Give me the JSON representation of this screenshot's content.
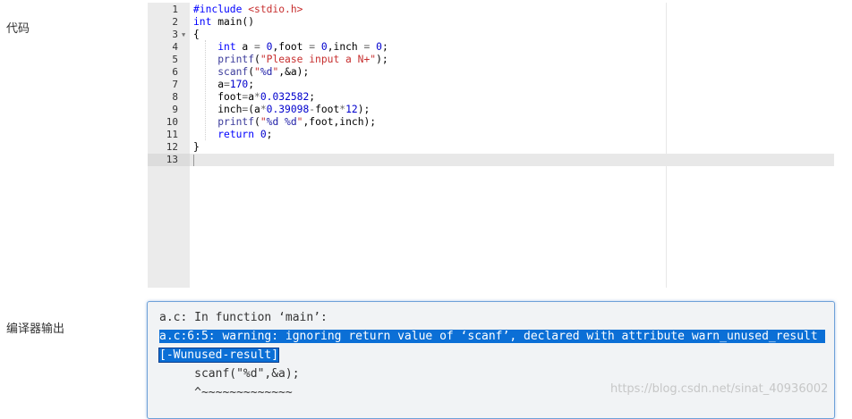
{
  "labels": {
    "code": "代码",
    "compiler_output": "编译器输出"
  },
  "editor": {
    "lines": [
      {
        "n": "1",
        "parts": [
          [
            "pp",
            "#include "
          ],
          [
            "inc",
            "<stdio.h>"
          ]
        ]
      },
      {
        "n": "2",
        "parts": [
          [
            "kw",
            "int"
          ],
          [
            "",
            " main()"
          ]
        ]
      },
      {
        "n": "3",
        "fold": true,
        "parts": [
          [
            "",
            "{"
          ]
        ]
      },
      {
        "n": "4",
        "parts": [
          [
            "",
            "    "
          ],
          [
            "kw",
            "int"
          ],
          [
            "",
            " a "
          ],
          [
            "op",
            "="
          ],
          [
            "",
            " "
          ],
          [
            "num",
            "0"
          ],
          [
            "",
            ",foot "
          ],
          [
            "op",
            "="
          ],
          [
            "",
            " "
          ],
          [
            "num",
            "0"
          ],
          [
            "",
            ",inch "
          ],
          [
            "op",
            "="
          ],
          [
            "",
            " "
          ],
          [
            "num",
            "0"
          ],
          [
            "",
            ";"
          ]
        ]
      },
      {
        "n": "5",
        "parts": [
          [
            "",
            "    "
          ],
          [
            "fn",
            "printf"
          ],
          [
            "",
            "("
          ],
          [
            "str",
            "\"Please input a N+\""
          ],
          [
            "",
            ");"
          ]
        ]
      },
      {
        "n": "6",
        "parts": [
          [
            "",
            "    "
          ],
          [
            "fn",
            "scanf"
          ],
          [
            "",
            "("
          ],
          [
            "str",
            "\""
          ],
          [
            "fmt",
            "%d"
          ],
          [
            "str",
            "\""
          ],
          [
            "",
            ",&a);"
          ]
        ]
      },
      {
        "n": "7",
        "parts": [
          [
            "",
            "    a"
          ],
          [
            "op",
            "="
          ],
          [
            "num",
            "170"
          ],
          [
            "",
            ";"
          ]
        ]
      },
      {
        "n": "8",
        "parts": [
          [
            "",
            "    foot"
          ],
          [
            "op",
            "="
          ],
          [
            "",
            "a"
          ],
          [
            "op",
            "*"
          ],
          [
            "num",
            "0.032582"
          ],
          [
            "",
            ";"
          ]
        ]
      },
      {
        "n": "9",
        "parts": [
          [
            "",
            "    inch"
          ],
          [
            "op",
            "="
          ],
          [
            "",
            "(a"
          ],
          [
            "op",
            "*"
          ],
          [
            "num",
            "0.39098"
          ],
          [
            "op",
            "-"
          ],
          [
            "",
            "foot"
          ],
          [
            "op",
            "*"
          ],
          [
            "num",
            "12"
          ],
          [
            "",
            ");"
          ]
        ]
      },
      {
        "n": "10",
        "parts": [
          [
            "",
            "    "
          ],
          [
            "fn",
            "printf"
          ],
          [
            "",
            "("
          ],
          [
            "str",
            "\""
          ],
          [
            "fmt",
            "%d %d"
          ],
          [
            "str",
            "\""
          ],
          [
            "",
            ",foot,inch);"
          ]
        ]
      },
      {
        "n": "11",
        "parts": [
          [
            "",
            "    "
          ],
          [
            "kw",
            "return"
          ],
          [
            "",
            " "
          ],
          [
            "num",
            "0"
          ],
          [
            "",
            ";"
          ]
        ]
      },
      {
        "n": "12",
        "parts": [
          [
            "",
            "}"
          ]
        ]
      },
      {
        "n": "13",
        "parts": [
          [
            "",
            ""
          ]
        ]
      }
    ]
  },
  "output": {
    "line1": "a.c: In function ‘main’:",
    "line2": "a.c:6:5: warning: ignoring return value of ‘scanf’, declared with attribute warn_unused_result ",
    "line3": "[-Wunused-result]",
    "line4": "     scanf(\"%d\",&a);",
    "line5": "     ^~~~~~~~~~~~~~"
  },
  "watermark": "https://blog.csdn.net/sinat_40936002",
  "colors": {
    "selection": "#0b6fd6",
    "gutter": "#ebebeb",
    "output_border": "#6ea1d8"
  }
}
